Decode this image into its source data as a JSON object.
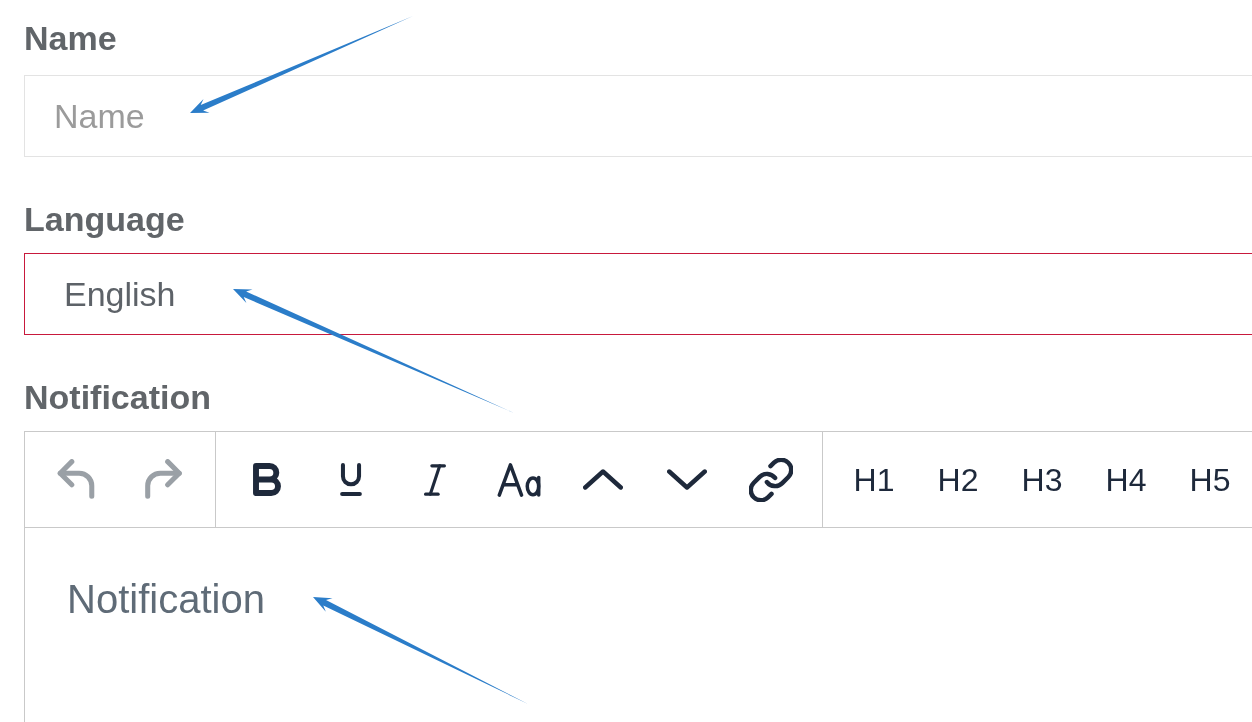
{
  "fields": [
    {
      "kind": "input",
      "label": "Name",
      "placeholder": "Name",
      "invalid": false
    },
    {
      "kind": "select",
      "label": "Language",
      "value": "English",
      "invalid": true
    }
  ],
  "editor": {
    "label": "Notification",
    "toolbar_groups": [
      {
        "buttons": [
          {
            "kind": "undo",
            "disabled": true
          },
          {
            "kind": "redo",
            "disabled": true
          }
        ]
      },
      {
        "buttons": [
          {
            "kind": "bold",
            "disabled": false
          },
          {
            "kind": "underline",
            "disabled": false
          },
          {
            "kind": "italic",
            "disabled": false
          },
          {
            "kind": "font_size",
            "disabled": false
          },
          {
            "kind": "move_up",
            "disabled": false
          },
          {
            "kind": "move_down",
            "disabled": false
          },
          {
            "kind": "link",
            "disabled": false
          }
        ]
      },
      {
        "buttons": [
          {
            "kind": "heading",
            "label": "H1",
            "disabled": false
          },
          {
            "kind": "heading",
            "label": "H2",
            "disabled": false
          },
          {
            "kind": "heading",
            "label": "H3",
            "disabled": false
          },
          {
            "kind": "heading",
            "label": "H4",
            "disabled": false
          },
          {
            "kind": "heading",
            "label": "H5",
            "disabled": false
          }
        ]
      }
    ],
    "placeholder": "Notification"
  }
}
